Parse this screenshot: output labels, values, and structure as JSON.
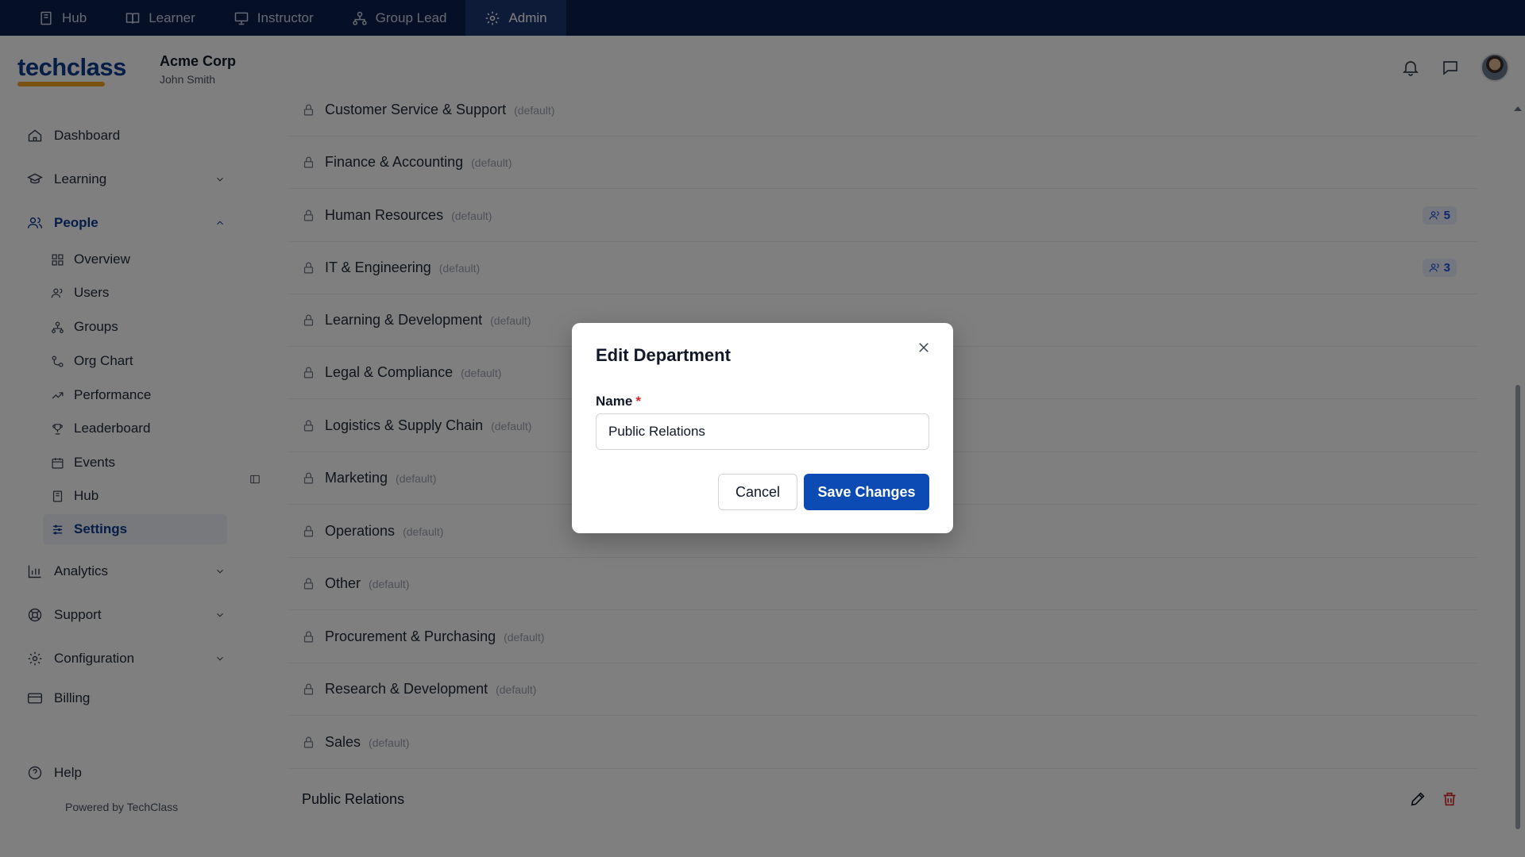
{
  "topbar": {
    "tabs": [
      {
        "label": "Hub",
        "icon": "book-icon"
      },
      {
        "label": "Learner",
        "icon": "open-book-icon"
      },
      {
        "label": "Instructor",
        "icon": "presentation-icon"
      },
      {
        "label": "Group Lead",
        "icon": "hierarchy-icon"
      },
      {
        "label": "Admin",
        "icon": "gear-icon",
        "active": true
      }
    ]
  },
  "header": {
    "logo_text": "techclass",
    "org_name": "Acme Corp",
    "user_name": "John Smith"
  },
  "sidebar": {
    "items": [
      {
        "label": "Dashboard"
      },
      {
        "label": "Learning"
      },
      {
        "label": "People"
      },
      {
        "label": "Analytics"
      },
      {
        "label": "Support"
      },
      {
        "label": "Configuration"
      },
      {
        "label": "Billing"
      },
      {
        "label": "Help"
      }
    ],
    "people_sub": [
      {
        "label": "Overview"
      },
      {
        "label": "Users"
      },
      {
        "label": "Groups"
      },
      {
        "label": "Org Chart"
      },
      {
        "label": "Performance"
      },
      {
        "label": "Leaderboard"
      },
      {
        "label": "Events"
      },
      {
        "label": "Hub"
      },
      {
        "label": "Settings"
      }
    ],
    "powered_by": "Powered by TechClass"
  },
  "departments": [
    {
      "name": "Customer Service & Support",
      "tag": "(default)"
    },
    {
      "name": "Finance & Accounting",
      "tag": "(default)"
    },
    {
      "name": "Human Resources",
      "tag": "(default)",
      "count": "5"
    },
    {
      "name": "IT & Engineering",
      "tag": "(default)",
      "count": "3"
    },
    {
      "name": "Learning & Development",
      "tag": "(default)"
    },
    {
      "name": "Legal & Compliance",
      "tag": "(default)"
    },
    {
      "name": "Logistics & Supply Chain",
      "tag": "(default)"
    },
    {
      "name": "Marketing",
      "tag": "(default)"
    },
    {
      "name": "Operations",
      "tag": "(default)"
    },
    {
      "name": "Other",
      "tag": "(default)"
    },
    {
      "name": "Procurement & Purchasing",
      "tag": "(default)"
    },
    {
      "name": "Research & Development",
      "tag": "(default)"
    },
    {
      "name": "Sales",
      "tag": "(default)"
    }
  ],
  "custom_department": {
    "name": "Public Relations"
  },
  "modal": {
    "title": "Edit Department",
    "name_label": "Name",
    "required_mark": "*",
    "name_value": "Public Relations",
    "cancel_label": "Cancel",
    "save_label": "Save Changes"
  },
  "colors": {
    "topbar_bg": "#0b1f4d",
    "primary": "#0b4bb3",
    "danger": "#dc2626"
  }
}
